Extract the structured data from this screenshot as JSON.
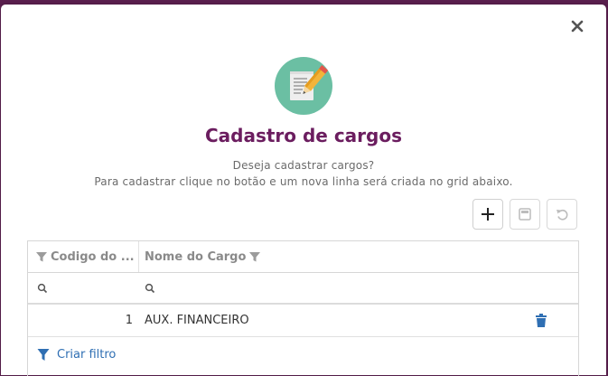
{
  "dialog": {
    "title": "Cadastro de cargos",
    "description_line1": "Deseja cadastrar cargos?",
    "description_line2": "Para cadastrar clique no botão e um nova linha será criada no grid abaixo.",
    "close_icon": "close-icon",
    "hero_icon": "document-pencil-icon"
  },
  "toolbar": {
    "add_icon": "plus-icon",
    "save_icon": "save-icon",
    "undo_icon": "undo-icon"
  },
  "grid": {
    "columns": [
      {
        "label": "Codigo do ...",
        "icon": "filter-icon"
      },
      {
        "label": "Nome do Cargo",
        "icon": "filter-icon"
      }
    ],
    "rows": [
      {
        "codigo": "1",
        "nome": "AUX. FINANCEIRO"
      }
    ],
    "footer_label": "Criar filtro"
  },
  "colors": {
    "title": "#6b1d5f",
    "accent": "#2f6fb3",
    "hero": "#6bbfa3",
    "backdrop": "#5a1f4e"
  }
}
